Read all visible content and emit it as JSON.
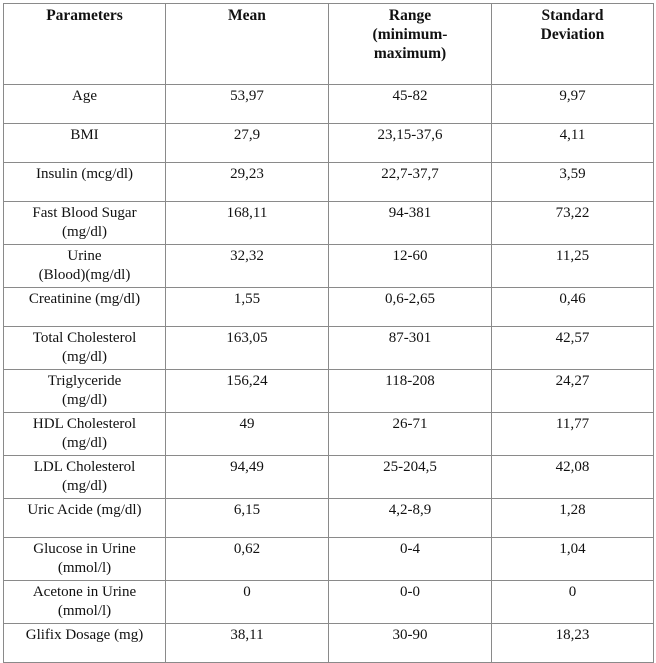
{
  "table": {
    "headers": [
      "Parameters",
      "Mean",
      "Range\n(minimum-\nmaximum)",
      "Standard\nDeviation"
    ],
    "header_lines": [
      [
        "Parameters"
      ],
      [
        "Mean"
      ],
      [
        "Range",
        "(minimum-",
        "maximum)"
      ],
      [
        "Standard",
        "Deviation"
      ]
    ],
    "rows": [
      {
        "parameter": [
          "Age"
        ],
        "mean": "53,97",
        "range": "45-82",
        "sd": "9,97"
      },
      {
        "parameter": [
          "BMI"
        ],
        "mean": "27,9",
        "range": "23,15-37,6",
        "sd": "4,11"
      },
      {
        "parameter": [
          "Insulin (mcg/dl)"
        ],
        "mean": "29,23",
        "range": "22,7-37,7",
        "sd": "3,59"
      },
      {
        "parameter": [
          "Fast Blood Sugar",
          "(mg/dl)"
        ],
        "mean": "168,11",
        "range": "94-381",
        "sd": "73,22"
      },
      {
        "parameter": [
          "Urine",
          "(Blood)(mg/dl)"
        ],
        "mean": "32,32",
        "range": "12-60",
        "sd": "11,25"
      },
      {
        "parameter": [
          "Creatinine (mg/dl)"
        ],
        "mean": "1,55",
        "range": "0,6-2,65",
        "sd": "0,46"
      },
      {
        "parameter": [
          "Total Cholesterol",
          "(mg/dl)"
        ],
        "mean": "163,05",
        "range": "87-301",
        "sd": "42,57"
      },
      {
        "parameter": [
          "Triglyceride",
          "(mg/dl)"
        ],
        "mean": "156,24",
        "range": "118-208",
        "sd": "24,27"
      },
      {
        "parameter": [
          "HDL Cholesterol",
          "(mg/dl)"
        ],
        "mean": "49",
        "range": "26-71",
        "sd": "11,77"
      },
      {
        "parameter": [
          "LDL Cholesterol",
          "(mg/dl)"
        ],
        "mean": "94,49",
        "range": "25-204,5",
        "sd": "42,08"
      },
      {
        "parameter": [
          "Uric Acide (mg/dl)"
        ],
        "mean": "6,15",
        "range": "4,2-8,9",
        "sd": "1,28"
      },
      {
        "parameter": [
          "Glucose in Urine",
          "(mmol/l)"
        ],
        "mean": "0,62",
        "range": "0-4",
        "sd": "1,04"
      },
      {
        "parameter": [
          "Acetone in Urine",
          "(mmol/l)"
        ],
        "mean": "0",
        "range": "0-0",
        "sd": "0"
      },
      {
        "parameter": [
          "Glifix Dosage (mg)"
        ],
        "mean": "38,11",
        "range": "30-90",
        "sd": "18,23"
      }
    ]
  }
}
